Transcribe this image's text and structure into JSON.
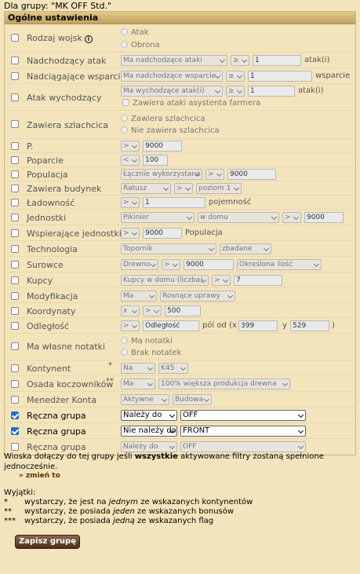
{
  "group_line": "Dla grupy: \"MK OFF Std.\"",
  "section_title": "Ogólne ustawienia",
  "rows": {
    "units": {
      "label": "Rodzaj wojsk",
      "info": "i",
      "r1": "Atak",
      "r2": "Obrona"
    },
    "incoming": {
      "label": "Nadchodzący atak",
      "s1": "Ma nadchodzące ataki",
      "s2": "≥",
      "v": "1",
      "unit": "atak(i)"
    },
    "support": {
      "label": "Nadciągające wsparcie",
      "s1": "Ma nadchodzące wsparcie",
      "s2": "≥",
      "v": "1",
      "unit": "wsparcie"
    },
    "outgoing": {
      "label": "Atak wychodzący",
      "s1": "Ma wychodzące atak(i)",
      "s2": "≥",
      "v": "1",
      "unit": "atak(i)",
      "check": "Zawiera ataki asystenta farmera"
    },
    "noble": {
      "label": "Zawiera szlachcica",
      "r1": "Zawiera szlachcica",
      "r2": "Nie zawiera szlachcica"
    },
    "points": {
      "label": "P.",
      "s1": ">",
      "v": "9000"
    },
    "loyalty": {
      "label": "Poparcie",
      "s1": "<",
      "v": "100"
    },
    "pop": {
      "label": "Populacja",
      "s1": "Łącznie wykorzystane",
      "s2": ">",
      "v": "9000"
    },
    "building": {
      "label": "Zawiera budynek",
      "s1": "Ratusz",
      "s2": ">",
      "s3": "poziom 1"
    },
    "capacity": {
      "label": "Ładowność",
      "s1": ">",
      "v": "1",
      "unit": "pojemność"
    },
    "unitsrow": {
      "label": "Jednostki",
      "s1": "Pikinier",
      "s2": "w domu",
      "s3": ">",
      "v": "9000"
    },
    "supunits": {
      "label": "Wspierające jednostki",
      "s1": ">",
      "v": "9000",
      "unit": "Populacja"
    },
    "tech": {
      "label": "Technologia",
      "s1": "Topornik",
      "s2": "zbadane"
    },
    "res": {
      "label": "Surowce",
      "s1": "Drewno",
      "s2": ">",
      "v": "9000",
      "s3": "Określona ilość"
    },
    "merch": {
      "label": "Kupcy",
      "s1": "Kupcy w domu (liczba)",
      "s2": ">",
      "v": "7"
    },
    "mod": {
      "label": "Modyfikacja",
      "s1": "Ma",
      "s2": "Rosnące uprawy"
    },
    "coords": {
      "label": "Koordynaty",
      "s1": "x",
      "s2": ">",
      "v": "500"
    },
    "dist": {
      "label": "Odległość",
      "s1": ">",
      "v": "Odległość",
      "t1": "pól od (x",
      "x": "399",
      "t2": "y",
      "y": "529",
      "t3": ")"
    },
    "notes": {
      "label": "Ma własne notatki",
      "r1": "Ma notatki",
      "r2": "Brak notatek"
    },
    "cont": {
      "label": "Kontynent",
      "star": "*",
      "s1": "Na",
      "s2": "K45"
    },
    "barb": {
      "label": "Osada koczowników",
      "star": "**",
      "s1": "Ma",
      "s2": "100% większa produkcja drewna"
    },
    "mgr": {
      "label": "Menedżer Konta",
      "s1": "Aktywne",
      "s2": "Budowa"
    },
    "g1": {
      "label": "Ręczna grupa",
      "s1": "Należy do",
      "s2": "OFF"
    },
    "g2": {
      "label": "Ręczna grupa",
      "s1": "Nie należy do",
      "s2": "FRONT"
    },
    "g3": {
      "label": "Ręczna grupa",
      "s1": "Należy do",
      "s2": "OFF"
    }
  },
  "footer": {
    "p1a": "Wioska dołączy do tej grupy jeśli ",
    "p1b": "wszystkie",
    "p1c": " aktywowane filtry zostaną spełnione",
    "p1d": "jednocześnie.",
    "change": "» zmień to",
    "exc": "Wyjątki:",
    "e1s": "*",
    "e1a": "wystarczy, że jest na ",
    "e1b": "jednym",
    "e1c": " ze wskazanych kontynentów",
    "e2s": "**",
    "e2a": "wystarczy, że posiada ",
    "e2b": "jeden",
    "e2c": " ze wskazanych bonusów",
    "e3s": "***",
    "e3a": "wystarczy, że posiada ",
    "e3b": "jedną",
    "e3c": " ze wskazanych flag"
  },
  "save_button": "Zapisz grupę"
}
